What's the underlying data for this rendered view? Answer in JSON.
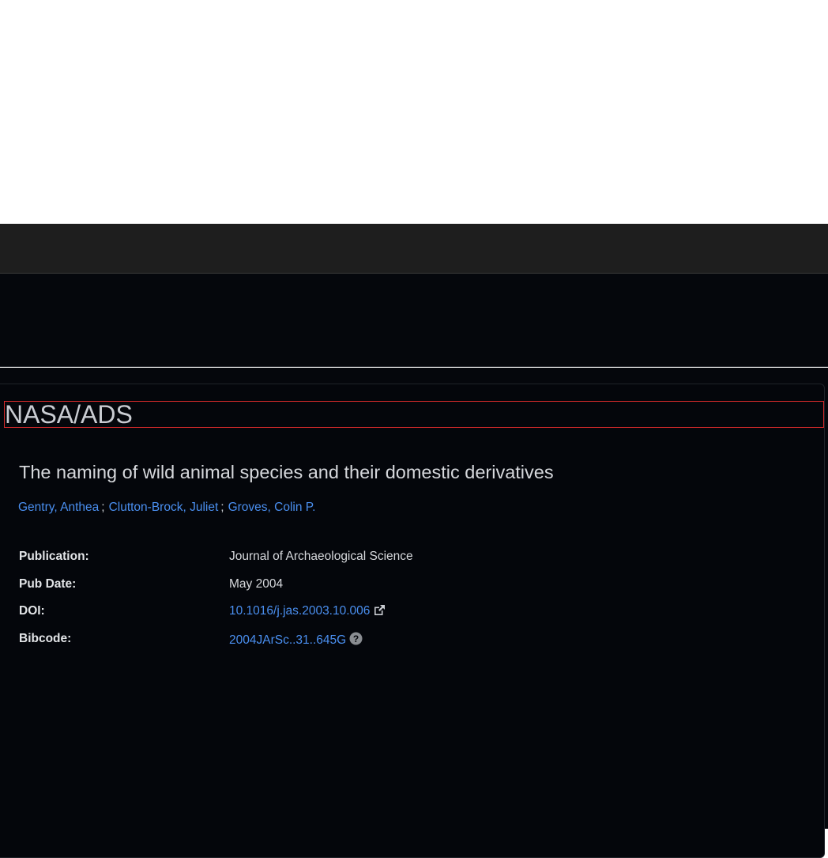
{
  "brand": {
    "name": "NASA/ADS"
  },
  "article": {
    "title": "The naming of wild animal species and their domestic derivatives",
    "authors": [
      {
        "name": "Gentry, Anthea"
      },
      {
        "name": "Clutton-Brock, Juliet"
      },
      {
        "name": "Groves, Colin P."
      }
    ],
    "separator": ";"
  },
  "meta": {
    "publication": {
      "label": "Publication:",
      "value": "Journal of Archaeological Science"
    },
    "pub_date": {
      "label": "Pub Date:",
      "value": "May 2004"
    },
    "doi": {
      "label": "DOI:",
      "value": "10.1016/j.jas.2003.10.006",
      "icon": "external-link-icon"
    },
    "bibcode": {
      "label": "Bibcode:",
      "value": "2004JArSc..31..645G",
      "icon": "question-circle-icon"
    }
  },
  "colors": {
    "background": "#05070c",
    "topbar": "#1e1e1e",
    "link": "#4a8ff0",
    "highlight_border": "#d42a2a"
  }
}
